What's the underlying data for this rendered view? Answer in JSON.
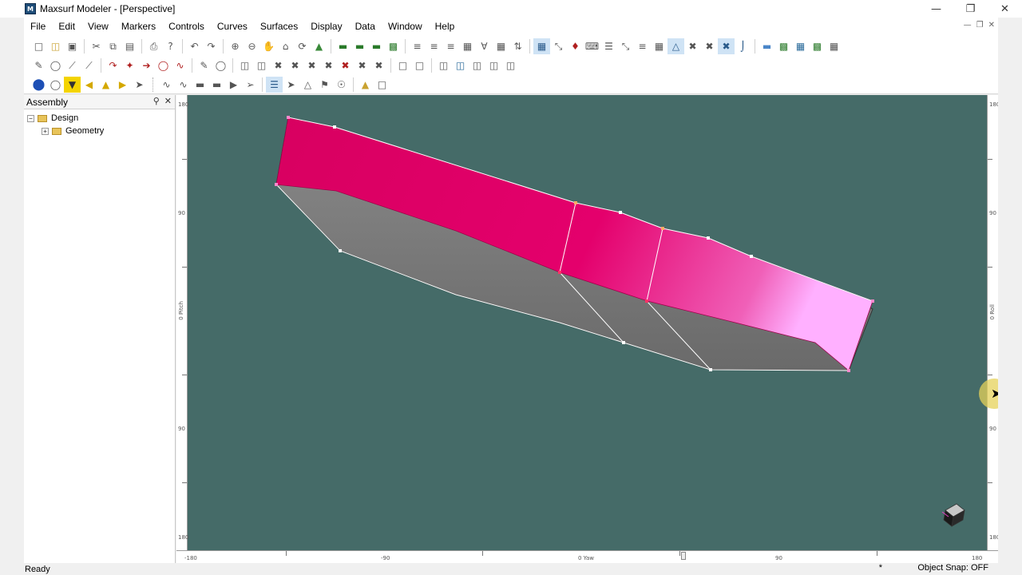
{
  "window": {
    "title": "Maxsurf Modeler - [Perspective]",
    "icon": "maxsurf-app-icon",
    "controls": [
      "minimize",
      "restore",
      "close"
    ]
  },
  "menu": {
    "items": [
      "File",
      "Edit",
      "View",
      "Markers",
      "Controls",
      "Curves",
      "Surfaces",
      "Display",
      "Data",
      "Window",
      "Help"
    ]
  },
  "toolbars": {
    "row1_icons": [
      "new-file-icon",
      "open-folder-icon",
      "save-icon",
      "cut-icon",
      "copy-icon",
      "paste-icon",
      "print-icon",
      "help-icon",
      "undo-icon",
      "redo-icon",
      "zoom-in-icon",
      "zoom-out-icon",
      "pan-hand-icon",
      "home-view-icon",
      "rotate-icon",
      "layer-icon",
      "render-icon",
      "shade-icon",
      "wireframe-icon",
      "display-icon"
    ],
    "row2_icons": [
      "pencil-icon",
      "circle-tool-icon",
      "line-tool-icon",
      "bezier-icon",
      "curve-icon",
      "point-icon",
      "arc-icon",
      "split-icon",
      "join-icon",
      "move-icon",
      "scale-icon"
    ],
    "row3_icons": [
      "sphere-blue-icon",
      "sphere-outline-icon",
      "marker-yellow-icon",
      "arrow-left-icon",
      "arrow-up-icon",
      "arrow-right-icon",
      "select-tool-icon"
    ]
  },
  "assembly": {
    "title": "Assembly",
    "tree": [
      {
        "label": "Design",
        "expanded": true,
        "level": 0
      },
      {
        "label": "Geometry",
        "expanded": false,
        "level": 1
      }
    ]
  },
  "viewport": {
    "view_name": "Perspective",
    "background_color": "#456b68",
    "hull_top_color": "#e8006c",
    "hull_side_color": "#7a7a7a",
    "rulers": {
      "bottom": [
        "-180",
        "-90",
        "0 Yaw",
        "90",
        "180"
      ],
      "left": [
        "180",
        "90",
        "0 Pitch",
        "90",
        "180"
      ],
      "right": [
        "180",
        "90",
        "0 Roll",
        "90",
        "180"
      ]
    }
  },
  "status": {
    "left": "Ready",
    "star": "*",
    "right": "Object Snap: OFF"
  }
}
